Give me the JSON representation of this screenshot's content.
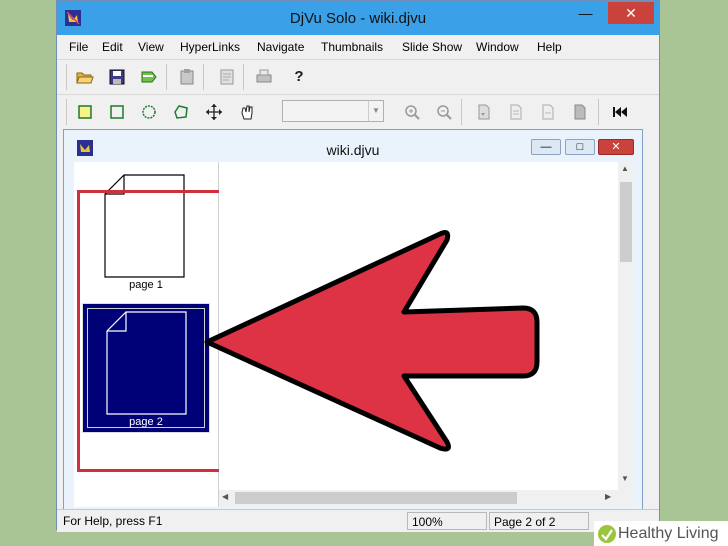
{
  "window": {
    "title": "DjVu Solo - wiki.djvu"
  },
  "window_controls": {
    "minimize": "—",
    "maximize": "☐",
    "close": "✕"
  },
  "menu": [
    "File",
    "Edit",
    "View",
    "HyperLinks",
    "Navigate",
    "Thumbnails",
    "Slide Show",
    "Window",
    "Help"
  ],
  "toolbar1": [
    {
      "icon": "open-folder-icon"
    },
    {
      "icon": "save-icon"
    },
    {
      "icon": "export-icon"
    },
    {
      "icon": "paste-icon"
    },
    {
      "icon": "page-properties-icon"
    },
    {
      "icon": "print-icon"
    },
    {
      "icon": "help-icon"
    }
  ],
  "toolbar2": [
    {
      "icon": "select-rect-icon"
    },
    {
      "icon": "select-icon"
    },
    {
      "icon": "select-circle-icon"
    },
    {
      "icon": "select-poly-icon"
    },
    {
      "icon": "move-icon"
    },
    {
      "icon": "pan-hand-icon"
    },
    {
      "icon": "zoom-in-icon"
    },
    {
      "icon": "zoom-out-icon"
    },
    {
      "icon": "page-icon-1"
    },
    {
      "icon": "page-icon-2"
    },
    {
      "icon": "page-icon-3"
    },
    {
      "icon": "page-icon-4"
    },
    {
      "icon": "first-page-icon"
    }
  ],
  "zoom_select": {
    "value": ""
  },
  "document": {
    "title": "wiki.djvu",
    "controls": {
      "minimize": "—",
      "maximize": "□",
      "close": "✕"
    },
    "thumbnails": [
      {
        "label": "page 1",
        "selected": false
      },
      {
        "label": "page 2",
        "selected": true
      }
    ]
  },
  "statusbar": {
    "help": "For Help, press F1",
    "zoom": "100%",
    "page": "Page 2 of 2"
  },
  "watermark": {
    "text": "Healthy Living"
  },
  "colors": {
    "highlight": "#d0303e",
    "selection": "#000077",
    "titlebar": "#3aa0e8"
  }
}
